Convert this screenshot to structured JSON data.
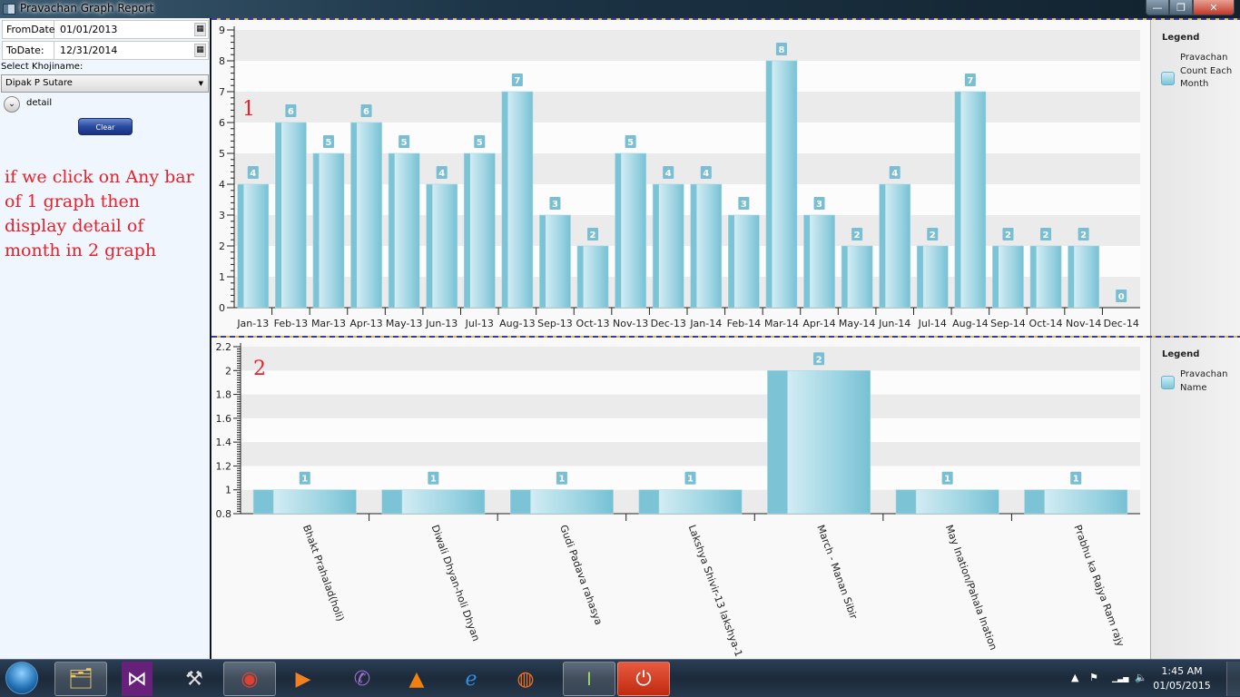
{
  "window": {
    "title": "Pravachan Graph Report",
    "controls": {
      "minimize": "—",
      "maximize": "❐",
      "close": "✕"
    }
  },
  "filters": {
    "from_label": "FromDate",
    "from_value": "01/01/2013",
    "to_label": "ToDate:",
    "to_value": "12/31/2014",
    "calendar_icon": "▦",
    "khoji_label": "Select Khojiname:",
    "khoji_selected": "Dipak P Sutare",
    "dropdown_arrow": "▼",
    "expander_icon": "⌄",
    "expander_label": "detail",
    "clear_label": "Clear"
  },
  "annotation": {
    "note": "if we click on Any bar of 1 graph then display detail of month in 2 graph",
    "chart1_marker": "1",
    "chart2_marker": "2"
  },
  "legends": {
    "chart1": {
      "title": "Legend",
      "label": "Pravachan Count Each Month"
    },
    "chart2": {
      "title": "Legend",
      "label": "Pravachan Name"
    }
  },
  "chart_data": [
    {
      "type": "bar",
      "title": "",
      "xlabel": "",
      "ylabel": "",
      "ylim": [
        0,
        9
      ],
      "yticks": [
        0,
        1,
        2,
        3,
        4,
        5,
        6,
        7,
        8,
        9
      ],
      "grid": "alternating horizontal bands",
      "legend": "right",
      "series_name": "Pravachan Count Each Month",
      "categories": [
        "Jan-13",
        "Feb-13",
        "Mar-13",
        "Apr-13",
        "May-13",
        "Jun-13",
        "Jul-13",
        "Aug-13",
        "Sep-13",
        "Oct-13",
        "Nov-13",
        "Dec-13",
        "Jan-14",
        "Feb-14",
        "Mar-14",
        "Apr-14",
        "May-14",
        "Jun-14",
        "Jul-14",
        "Aug-14",
        "Sep-14",
        "Oct-14",
        "Nov-14",
        "Dec-14"
      ],
      "values": [
        4,
        6,
        5,
        6,
        5,
        4,
        5,
        7,
        3,
        2,
        5,
        4,
        4,
        3,
        8,
        3,
        2,
        4,
        2,
        7,
        2,
        2,
        2,
        0
      ]
    },
    {
      "type": "bar",
      "title": "",
      "xlabel": "",
      "ylabel": "",
      "ylim": [
        0.8,
        2.2
      ],
      "yticks": [
        0.8,
        1,
        1.2,
        1.4,
        1.6,
        1.8,
        2,
        2.2
      ],
      "grid": "alternating horizontal bands",
      "legend": "right",
      "series_name": "Pravachan Name",
      "categories": [
        "Bhakt Prahalad(holi)",
        "Diwali Dhyan-holi Dhyan",
        "Gudi Padava rahasya",
        "Lakshya Shivir-13 lakshya-1",
        "March - Manan Sibir",
        "May Ination/Pahala Ination",
        "Prabhu ka Rajya Ram rajy"
      ],
      "values": [
        1,
        1,
        1,
        1,
        2,
        1,
        1
      ]
    }
  ],
  "taskbar": {
    "items": [
      {
        "name": "file-explorer",
        "glyph": "🗂"
      },
      {
        "name": "visual-studio",
        "glyph": "⋈"
      },
      {
        "name": "tools",
        "glyph": "⚒"
      },
      {
        "name": "chrome",
        "glyph": "◉"
      },
      {
        "name": "media-player",
        "glyph": "▶"
      },
      {
        "name": "viber",
        "glyph": "✆"
      },
      {
        "name": "vlc",
        "glyph": "▲"
      },
      {
        "name": "internet-explorer",
        "glyph": "ℯ"
      },
      {
        "name": "firefox",
        "glyph": "◍"
      },
      {
        "name": "app-toggle",
        "glyph": "⏽"
      },
      {
        "name": "power-app",
        "glyph": "⏻"
      }
    ],
    "clock_time": "1:45 AM",
    "clock_date": "01/05/2015",
    "tray_icons": {
      "expand": "▲",
      "flag": "⚑",
      "signal": "▁▃▅",
      "volume": "🔈"
    }
  }
}
